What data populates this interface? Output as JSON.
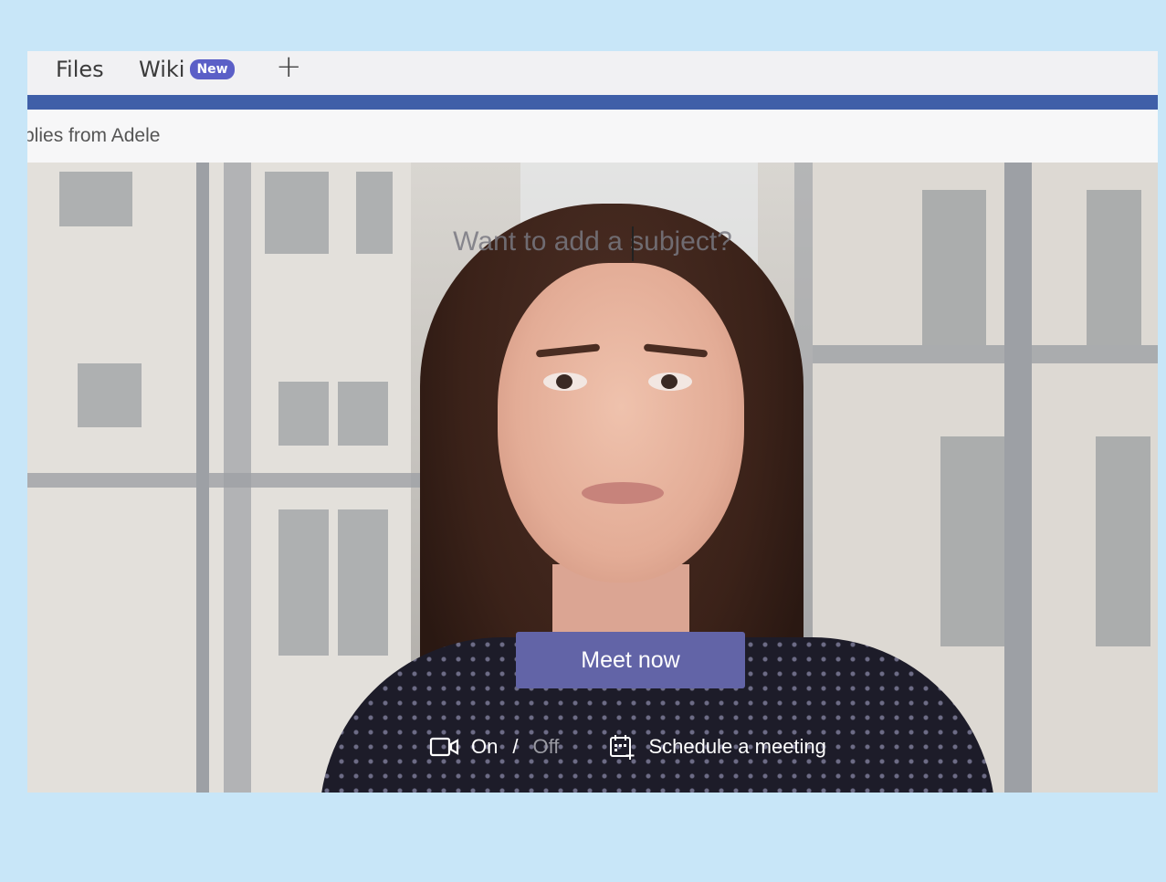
{
  "tabs": {
    "files_label": "Files",
    "wiki_label": "Wiki",
    "wiki_badge": "New",
    "add_tab_label": "+"
  },
  "thread": {
    "replies_text": "plies from Adele"
  },
  "meeting": {
    "subject_placeholder": "Want to add a subject?",
    "meet_now_label": "Meet now",
    "video_on_label": "On",
    "separator": "/",
    "video_off_label": "Off",
    "schedule_label": "Schedule a meeting"
  },
  "colors": {
    "background": "#c8e6f8",
    "accent_bar": "#3f5fa8",
    "button": "#6264a7",
    "badge": "#5b5fc7"
  },
  "icons": {
    "camera": "camera-icon",
    "calendar": "calendar-add-icon"
  }
}
